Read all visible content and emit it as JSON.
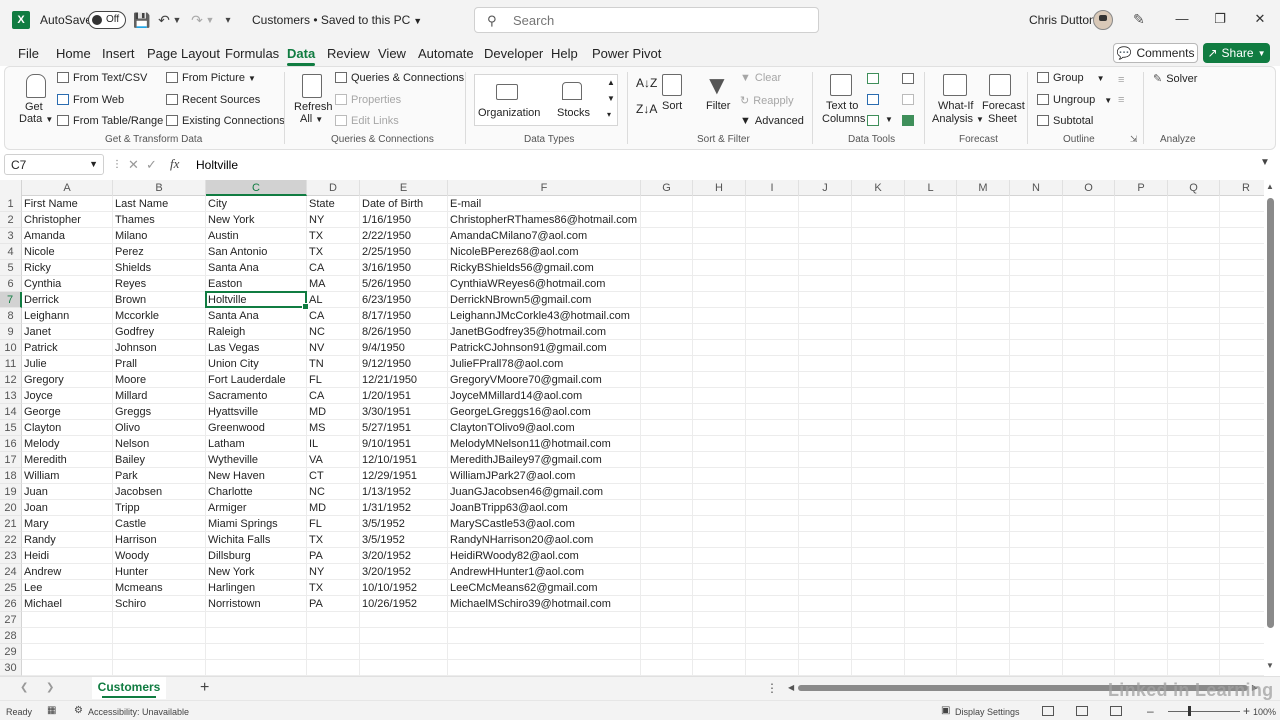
{
  "titlebar": {
    "autosave_label": "AutoSave",
    "autosave_state": "Off",
    "doc_title": "Customers • Saved to this PC",
    "search_placeholder": "Search",
    "user_name": "Chris Dutton"
  },
  "menu": {
    "tabs": [
      "File",
      "Home",
      "Insert",
      "Page Layout",
      "Formulas",
      "Data",
      "Review",
      "View",
      "Automate",
      "Developer",
      "Help",
      "Power Pivot"
    ],
    "active_tab": "Data",
    "comments_label": "Comments",
    "share_label": "Share"
  },
  "ribbon": {
    "get_transform": {
      "get_data": [
        "Get",
        "Data"
      ],
      "from_text_csv": "From Text/CSV",
      "from_web": "From Web",
      "from_table_range": "From Table/Range",
      "from_picture": "From Picture",
      "recent_sources": "Recent Sources",
      "existing_connections": "Existing Connections",
      "group_name": "Get & Transform Data"
    },
    "queries": {
      "refresh": [
        "Refresh",
        "All"
      ],
      "queries_connections": "Queries & Connections",
      "properties": "Properties",
      "edit_links": "Edit Links",
      "group_name": "Queries & Connections"
    },
    "data_types": {
      "organization": "Organization",
      "stocks": "Stocks",
      "group_name": "Data Types"
    },
    "sort_filter": {
      "sort": "Sort",
      "filter": "Filter",
      "clear": "Clear",
      "reapply": "Reapply",
      "advanced": "Advanced",
      "group_name": "Sort & Filter"
    },
    "data_tools": {
      "text_to_columns": [
        "Text to",
        "Columns"
      ],
      "group_name": "Data Tools"
    },
    "forecast": {
      "what_if": [
        "What-If",
        "Analysis"
      ],
      "forecast_sheet": [
        "Forecast",
        "Sheet"
      ],
      "group_name": "Forecast"
    },
    "outline": {
      "group": "Group",
      "ungroup": "Ungroup",
      "subtotal": "Subtotal",
      "group_name": "Outline"
    },
    "analyze": {
      "solver": "Solver",
      "group_name": "Analyze"
    }
  },
  "formula_bar": {
    "name_box": "C7",
    "fx": "fx",
    "formula": "Holtville"
  },
  "sheet": {
    "columns": [
      "A",
      "B",
      "C",
      "D",
      "E",
      "F",
      "G",
      "H",
      "I",
      "J",
      "K",
      "L",
      "M",
      "N",
      "O",
      "P",
      "Q",
      "R"
    ],
    "selected_column": "C",
    "selected_row": 7,
    "row_count": 30,
    "rows": [
      [
        "First Name",
        "Last Name",
        "City",
        "State",
        "Date of Birth",
        "E-mail"
      ],
      [
        "Christopher",
        "Thames",
        "New York",
        "NY",
        "1/16/1950",
        "ChristopherRThames86@hotmail.com"
      ],
      [
        "Amanda",
        "Milano",
        "Austin",
        "TX",
        "2/22/1950",
        "AmandaCMilano7@aol.com"
      ],
      [
        "Nicole",
        "Perez",
        "San Antonio",
        "TX",
        "2/25/1950",
        "NicoleBPerez68@aol.com"
      ],
      [
        "Ricky",
        "Shields",
        "Santa Ana",
        "CA",
        "3/16/1950",
        "RickyBShields56@gmail.com"
      ],
      [
        "Cynthia",
        "Reyes",
        "Easton",
        "MA",
        "5/26/1950",
        "CynthiaWReyes6@hotmail.com"
      ],
      [
        "Derrick",
        "Brown",
        "Holtville",
        "AL",
        "6/23/1950",
        "DerrickNBrown5@gmail.com"
      ],
      [
        "Leighann",
        "Mccorkle",
        "Santa Ana",
        "CA",
        "8/17/1950",
        "LeighannJMcCorkle43@hotmail.com"
      ],
      [
        "Janet",
        "Godfrey",
        "Raleigh",
        "NC",
        "8/26/1950",
        "JanetBGodfrey35@hotmail.com"
      ],
      [
        "Patrick",
        "Johnson",
        "Las Vegas",
        "NV",
        "9/4/1950",
        "PatrickCJohnson91@gmail.com"
      ],
      [
        "Julie",
        "Prall",
        "Union City",
        "TN",
        "9/12/1950",
        "JulieFPrall78@aol.com"
      ],
      [
        "Gregory",
        "Moore",
        "Fort Lauderdale",
        "FL",
        "12/21/1950",
        "GregoryVMoore70@gmail.com"
      ],
      [
        "Joyce",
        "Millard",
        "Sacramento",
        "CA",
        "1/20/1951",
        "JoyceMMillard14@aol.com"
      ],
      [
        "George",
        "Greggs",
        "Hyattsville",
        "MD",
        "3/30/1951",
        "GeorgeLGreggs16@aol.com"
      ],
      [
        "Clayton",
        "Olivo",
        "Greenwood",
        "MS",
        "5/27/1951",
        "ClaytonTOlivo9@aol.com"
      ],
      [
        "Melody",
        "Nelson",
        "Latham",
        "IL",
        "9/10/1951",
        "MelodyMNelson11@hotmail.com"
      ],
      [
        "Meredith",
        "Bailey",
        "Wytheville",
        "VA",
        "12/10/1951",
        "MeredithJBailey97@gmail.com"
      ],
      [
        "William",
        "Park",
        "New Haven",
        "CT",
        "12/29/1951",
        "WilliamJPark27@aol.com"
      ],
      [
        "Juan",
        "Jacobsen",
        "Charlotte",
        "NC",
        "1/13/1952",
        "JuanGJacobsen46@gmail.com"
      ],
      [
        "Joan",
        "Tripp",
        "Armiger",
        "MD",
        "1/31/1952",
        "JoanBTripp63@aol.com"
      ],
      [
        "Mary",
        "Castle",
        "Miami Springs",
        "FL",
        "3/5/1952",
        "MarySCastle53@aol.com"
      ],
      [
        "Randy",
        "Harrison",
        "Wichita Falls",
        "TX",
        "3/5/1952",
        "RandyNHarrison20@aol.com"
      ],
      [
        "Heidi",
        "Woody",
        "Dillsburg",
        "PA",
        "3/20/1952",
        "HeidiRWoody82@aol.com"
      ],
      [
        "Andrew",
        "Hunter",
        "New York",
        "NY",
        "3/20/1952",
        "AndrewHHunter1@aol.com"
      ],
      [
        "Lee",
        "Mcmeans",
        "Harlingen",
        "TX",
        "10/10/1952",
        "LeeCMcMeans62@gmail.com"
      ],
      [
        "Michael",
        "Schiro",
        "Norristown",
        "PA",
        "10/26/1952",
        "MichaelMSchiro39@hotmail.com"
      ]
    ]
  },
  "sheet_tabs": {
    "active": "Customers"
  },
  "status": {
    "ready": "Ready",
    "accessibility": "Accessibility: Unavailable",
    "display_settings": "Display Settings",
    "zoom": "100%"
  },
  "watermark": "Linked in Learning"
}
